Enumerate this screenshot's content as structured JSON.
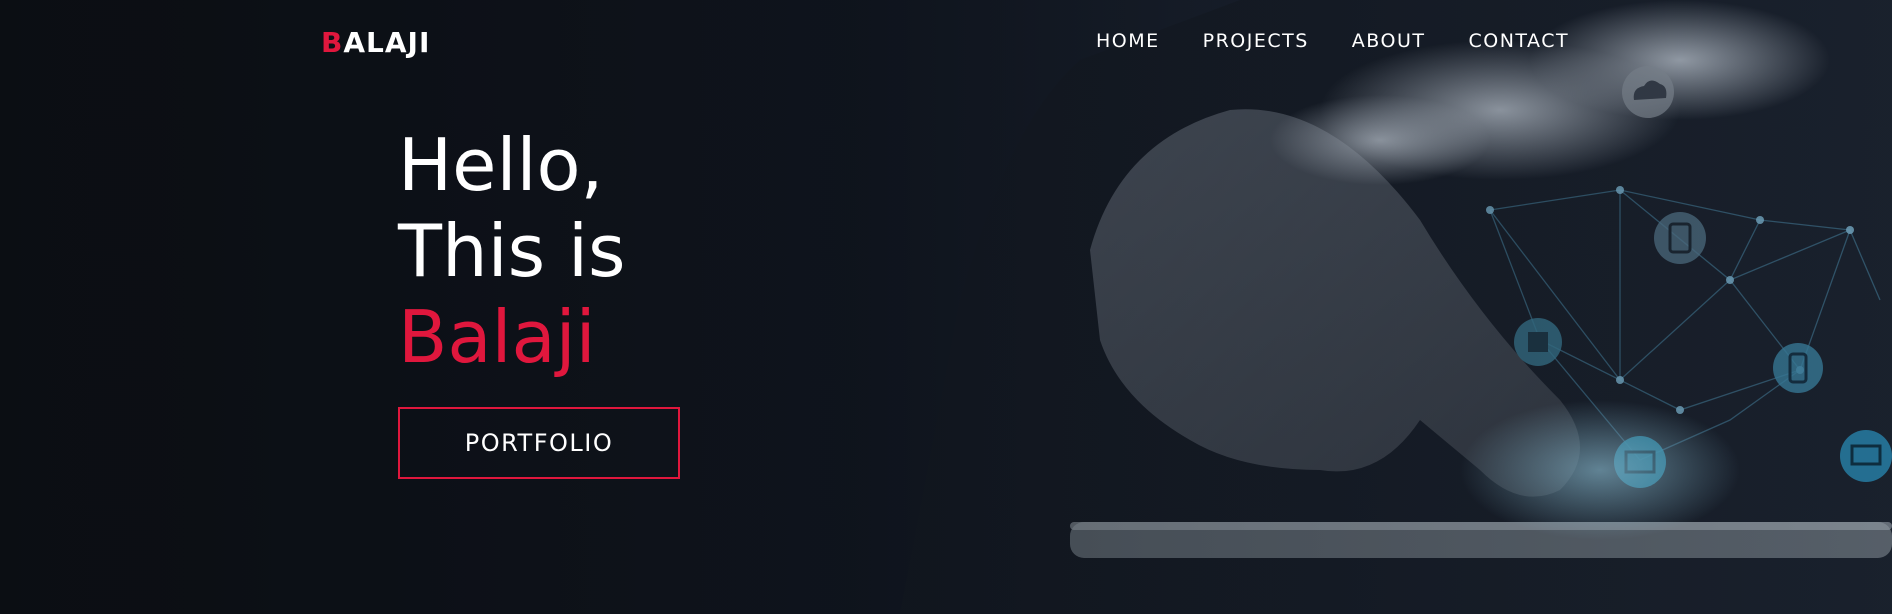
{
  "header": {
    "logo_first_letter": "B",
    "logo_rest": "ALAJI"
  },
  "nav": {
    "items": [
      {
        "label": "HOME"
      },
      {
        "label": "PROJECTS"
      },
      {
        "label": "ABOUT"
      },
      {
        "label": "CONTACT"
      }
    ]
  },
  "hero": {
    "line1": "Hello,",
    "line2": "This is",
    "name": "Balaji",
    "cta_label": "PORTFOLIO"
  },
  "colors": {
    "accent": "#e0173d",
    "text": "#ffffff",
    "background": "#0d1117"
  },
  "background_icons": [
    "cloud-icon",
    "tablet-icon",
    "mobile-icon",
    "gallery-icon",
    "laptop-icon",
    "book-icon"
  ]
}
